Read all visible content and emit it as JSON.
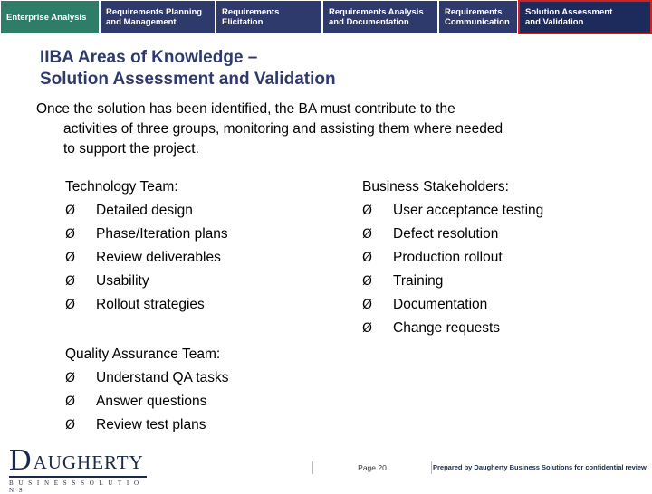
{
  "tabs": [
    {
      "line1": "Enterprise Analysis",
      "line2": ""
    },
    {
      "line1": "Requirements Planning",
      "line2": "and Management"
    },
    {
      "line1": "Requirements Elicitation",
      "line2": ""
    },
    {
      "line1": "Requirements Analysis",
      "line2": "and Documentation"
    },
    {
      "line1": "Requirements",
      "line2": "Communication"
    },
    {
      "line1": "Solution Assessment",
      "line2": "and Validation"
    }
  ],
  "title": {
    "line1": "IIBA Areas of Knowledge –",
    "line2": "Solution Assessment and Validation"
  },
  "intro": {
    "line1": "Once the solution has been identified, the BA must contribute to the",
    "line2": "activities of three groups, monitoring and assisting them where needed",
    "line3": "to support the project."
  },
  "groups": {
    "technology": {
      "heading": "Technology Team:",
      "items": [
        "Detailed design",
        "Phase/Iteration plans",
        "Review deliverables",
        "Usability",
        "Rollout strategies"
      ]
    },
    "business": {
      "heading": "Business Stakeholders:",
      "items": [
        "User acceptance testing",
        "Defect resolution",
        "Production rollout",
        "Training",
        "Documentation",
        "Change requests"
      ]
    },
    "quality": {
      "heading": "Quality Assurance Team:",
      "items": [
        "Understand QA tasks",
        "Answer questions",
        "Review test plans"
      ]
    }
  },
  "bullet_glyph": "Ø",
  "footer": {
    "logo_initial": "D",
    "logo_word": "AUGHERTY",
    "logo_sub": "B U S I N E S S   S O L U T I O N S",
    "page": "Page 20",
    "confidential": "Prepared by Daugherty Business Solutions for confidential review"
  },
  "colors": {
    "tab_default": "#2e3a6b",
    "tab_first": "#2e7d68",
    "tab_active_border": "#cc2222",
    "title": "#2e3a6b"
  }
}
